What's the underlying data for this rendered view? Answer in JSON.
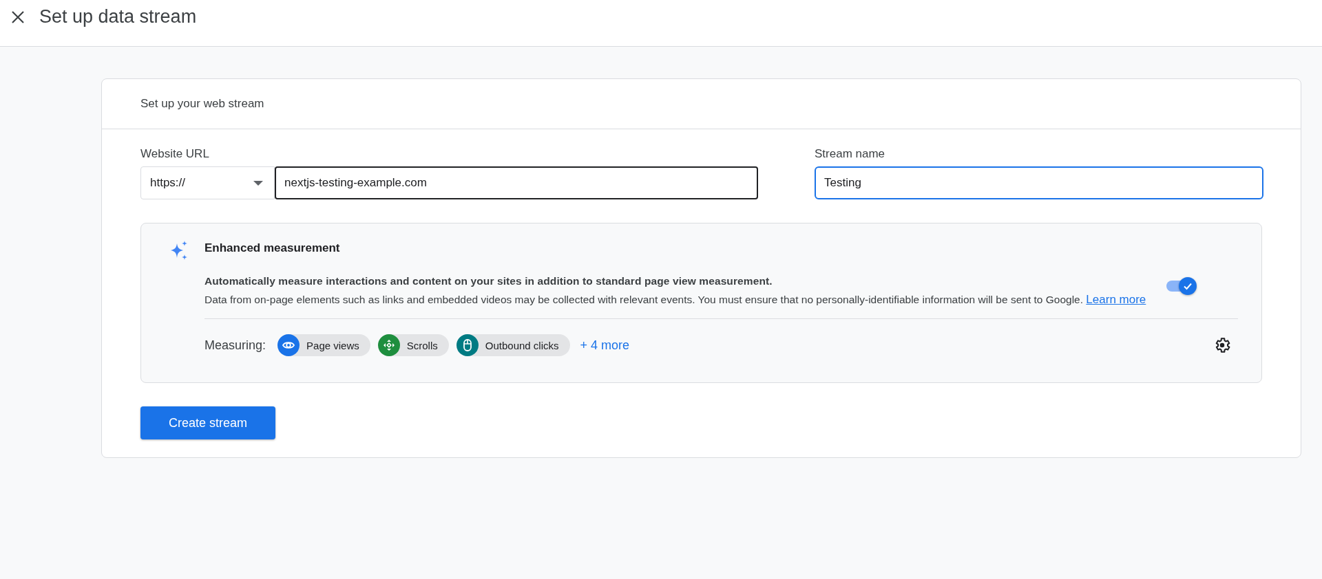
{
  "header": {
    "title": "Set up data stream"
  },
  "card": {
    "title": "Set up your web stream",
    "url_field": {
      "label": "Website URL",
      "protocol": "https://",
      "value": "nextjs-testing-example.com"
    },
    "name_field": {
      "label": "Stream name",
      "value": "Testing"
    },
    "enhanced": {
      "title": "Enhanced measurement",
      "summary": "Automatically measure interactions and content on your sites in addition to standard page view measurement.",
      "details": "Data from on-page elements such as links and embedded videos may be collected with relevant events. You must ensure that no personally-identifiable information will be sent to Google.",
      "link": "Learn more",
      "enabled": true,
      "measuring_label": "Measuring:",
      "events": [
        {
          "kind": "eye",
          "label": "Page views",
          "color": "#1a73e8"
        },
        {
          "kind": "scroll",
          "label": "Scrolls",
          "color": "#1e8e3e"
        },
        {
          "kind": "mouse",
          "label": "Outbound clicks",
          "color": "#007b83"
        }
      ],
      "more": "+ 4 more"
    },
    "submit": "Create stream"
  }
}
